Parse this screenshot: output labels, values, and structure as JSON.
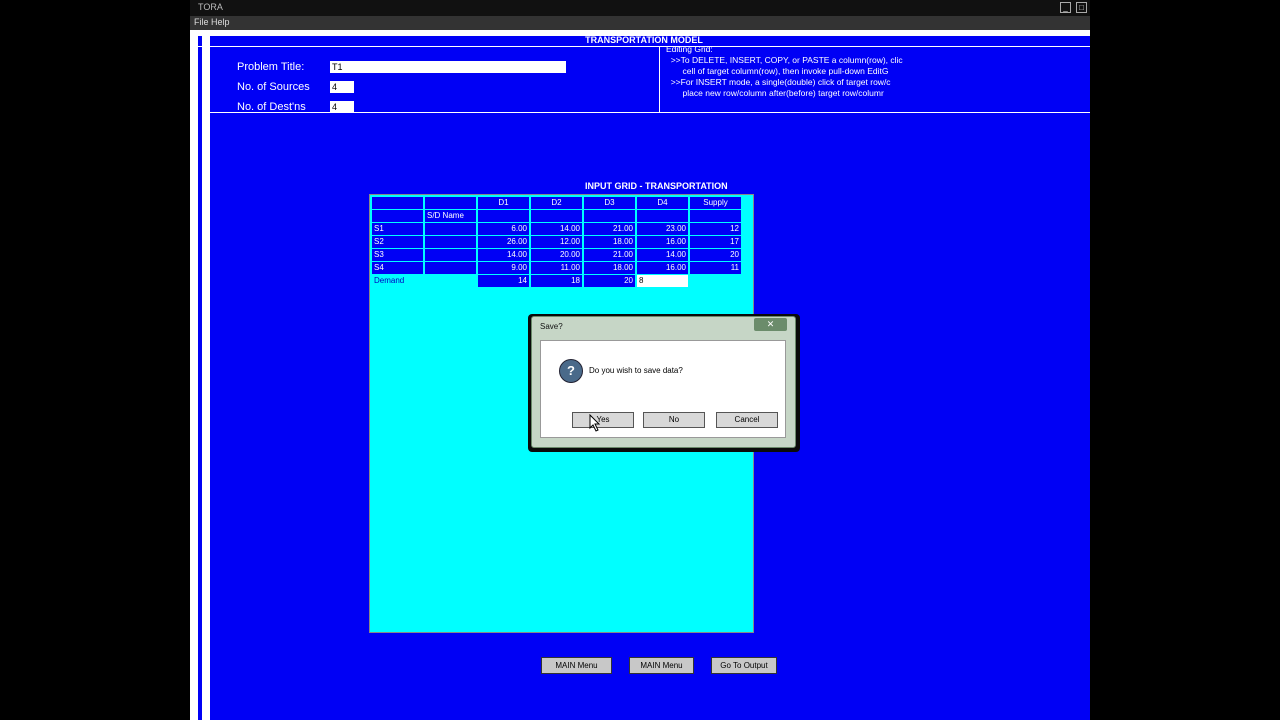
{
  "window": {
    "title": "TORA",
    "menu_text": "File  Help"
  },
  "model_title": "TRANSPORTATION MODEL",
  "form": {
    "problem_title_label": "Problem Title:",
    "problem_title_value": "T1",
    "sources_label": "No. of Sources",
    "sources_value": "4",
    "destinations_label": "No. of Dest'ns",
    "destinations_value": "4"
  },
  "help_text": "Editing Grid:\n  >>To DELETE, INSERT, COPY, or PASTE a column(row), clic\n       cell of target column(row), then invoke pull-down EditG\n  >>For INSERT mode, a single(double) click of target row/c\n       place new row/column after(before) target row/columr",
  "grid": {
    "title": "INPUT GRID - TRANSPORTATION",
    "name_header": "S/D Name",
    "columns": [
      "D1",
      "D2",
      "D3",
      "D4",
      "Supply"
    ],
    "rows": [
      {
        "label": "S1",
        "costs": [
          "6.00",
          "14.00",
          "21.00",
          "23.00"
        ],
        "supply": "12"
      },
      {
        "label": "S2",
        "costs": [
          "26.00",
          "12.00",
          "18.00",
          "16.00"
        ],
        "supply": "17"
      },
      {
        "label": "S3",
        "costs": [
          "14.00",
          "20.00",
          "21.00",
          "14.00"
        ],
        "supply": "20"
      },
      {
        "label": "S4",
        "costs": [
          "9.00",
          "11.00",
          "18.00",
          "16.00"
        ],
        "supply": "11"
      }
    ],
    "demand_label": "Demand",
    "demand": [
      "14",
      "18",
      "20",
      "8"
    ]
  },
  "dialog": {
    "title": "Save?",
    "close_symbol": "✕",
    "icon_glyph": "?",
    "message": "Do you wish to save data?",
    "yes": "Yes",
    "no": "No",
    "cancel": "Cancel"
  },
  "bottom_buttons": {
    "main_menu": "MAIN Menu",
    "main_menu2": "MAIN Menu",
    "go_to_output": "Go To Output"
  },
  "colors": {
    "background": "#0000f5",
    "grid_panel": "#00ffff"
  }
}
